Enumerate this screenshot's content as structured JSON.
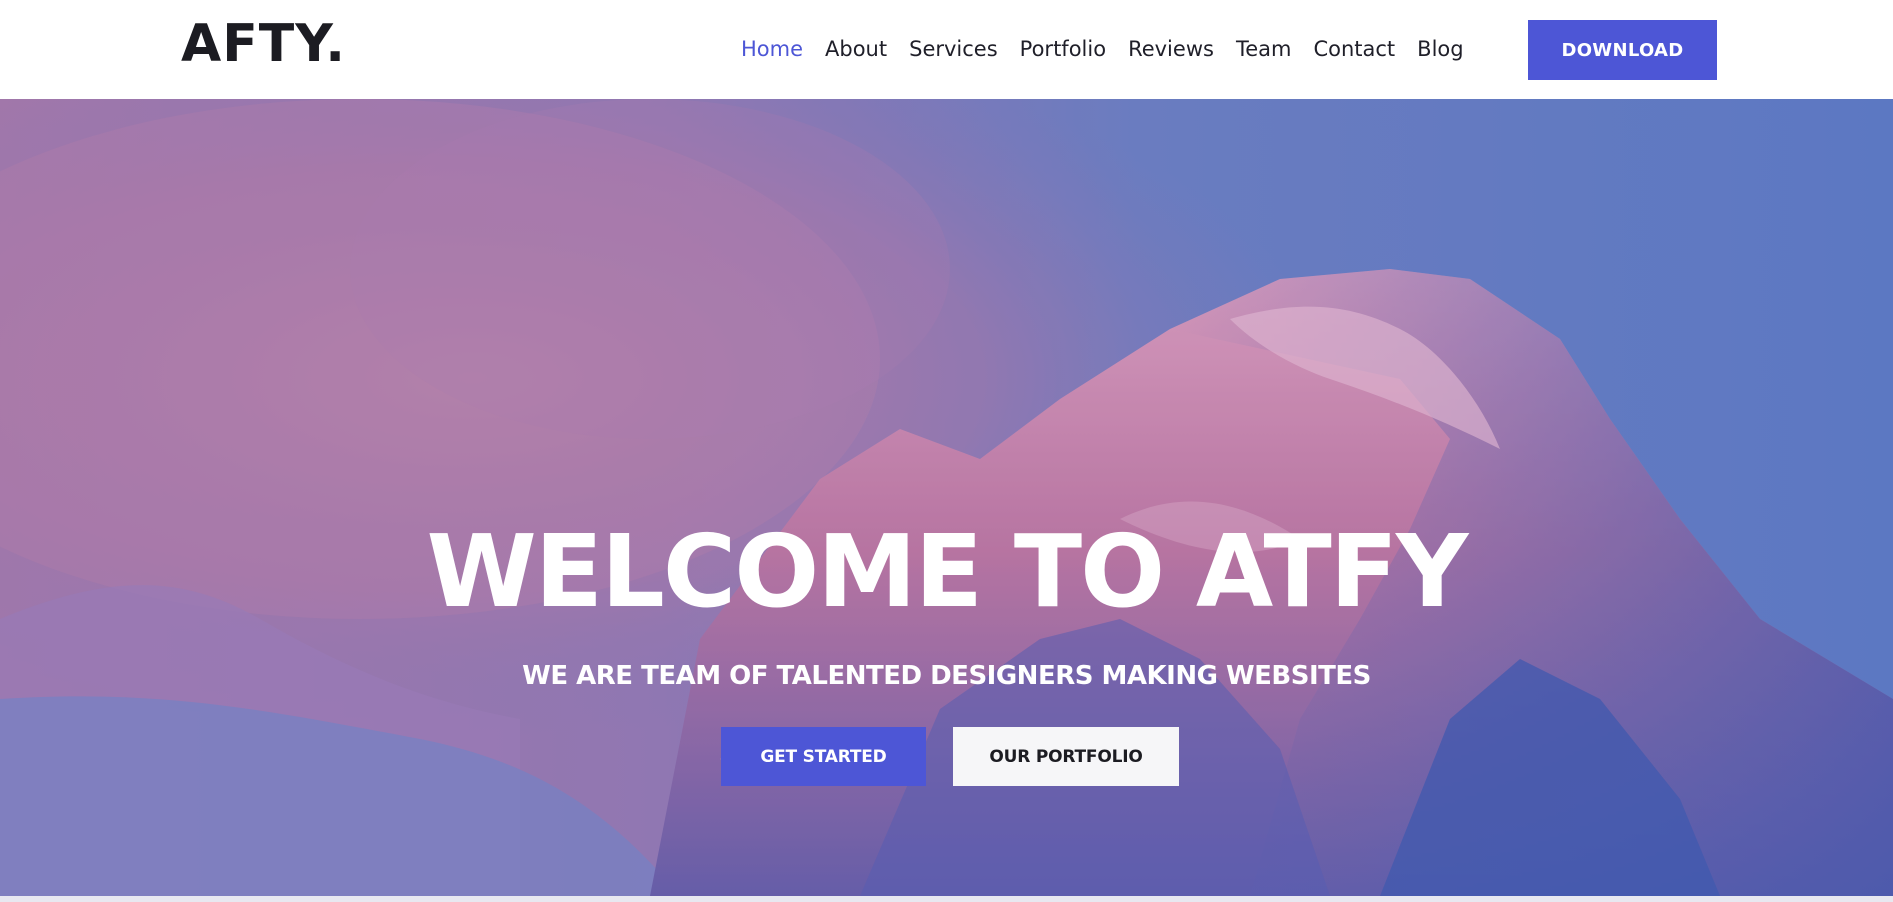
{
  "brand": {
    "logo_text": "AFTY."
  },
  "nav": {
    "items": [
      {
        "label": "Home",
        "active": true
      },
      {
        "label": "About",
        "active": false
      },
      {
        "label": "Services",
        "active": false
      },
      {
        "label": "Portfolio",
        "active": false
      },
      {
        "label": "Reviews",
        "active": false
      },
      {
        "label": "Team",
        "active": false
      },
      {
        "label": "Contact",
        "active": false
      },
      {
        "label": "Blog",
        "active": false
      }
    ],
    "download_label": "DOWNLOAD"
  },
  "hero": {
    "title": "WELCOME TO ATFY",
    "subtitle": "WE ARE TEAM OF TALENTED DESIGNERS MAKING WEBSITES",
    "primary_cta": "GET STARTED",
    "secondary_cta": "OUR PORTFOLIO",
    "background_description_icon": "mountain-landscape-image"
  },
  "colors": {
    "accent": "#4d56d6",
    "text_dark": "#1c1c22",
    "hero_overlay": "#5f78c0",
    "header_bg": "#ffffff"
  }
}
